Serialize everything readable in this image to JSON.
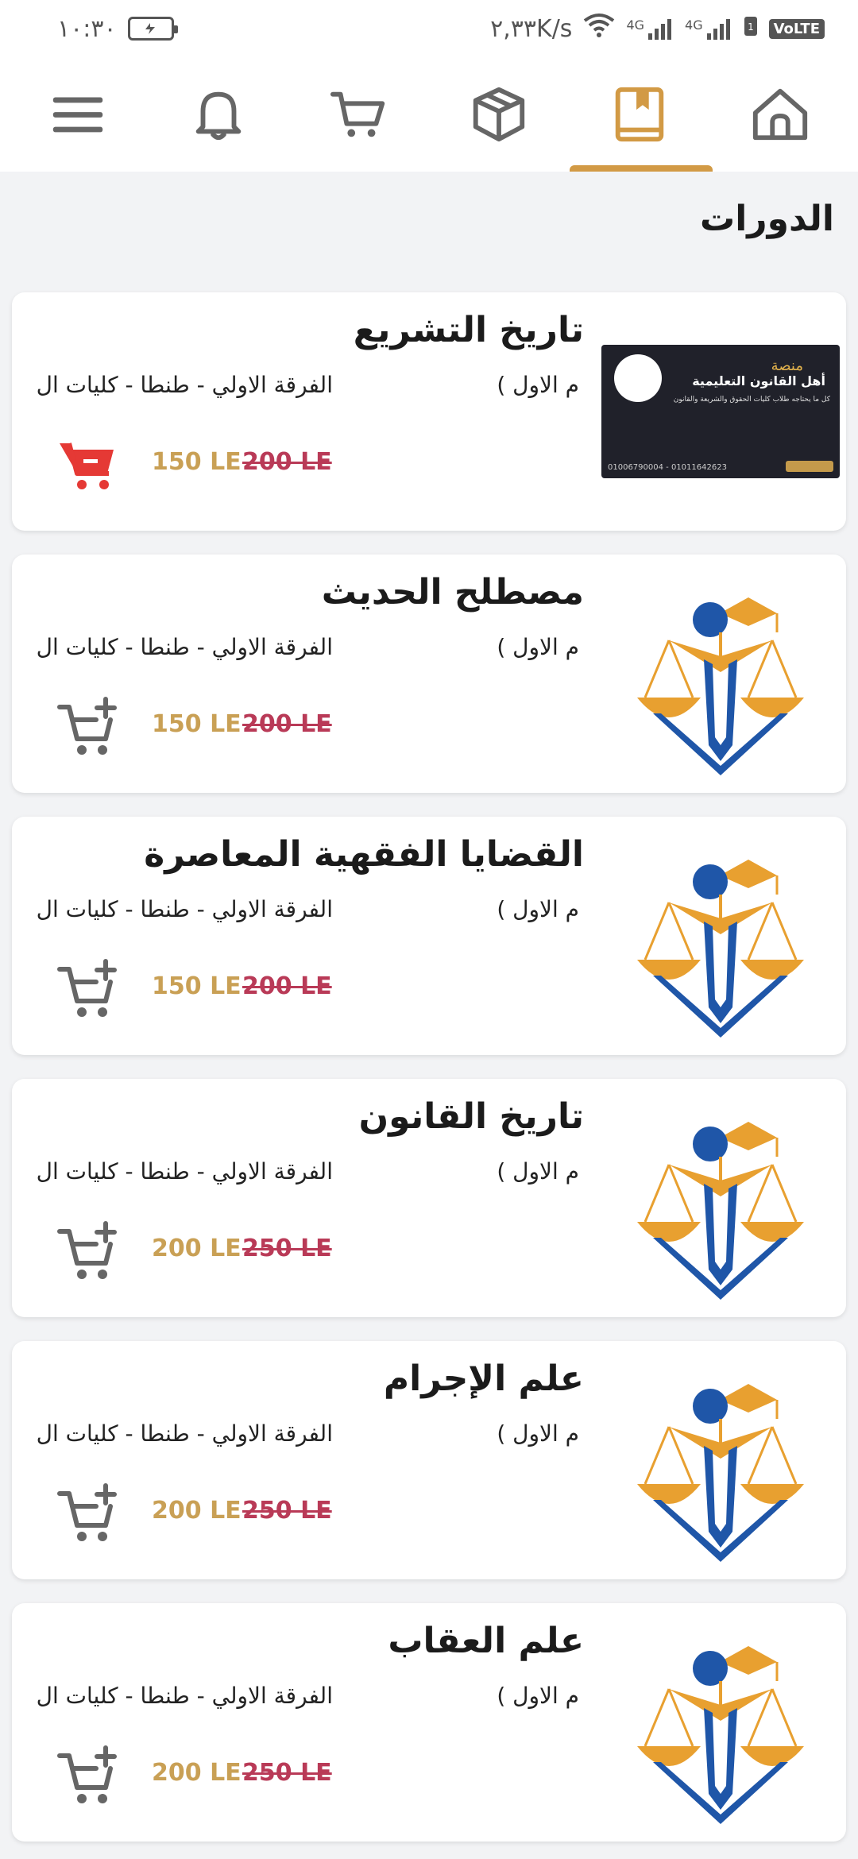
{
  "status_bar": {
    "time": "١٠:٣٠",
    "net_speed": "٢,٣٣K/s",
    "net_4g_1": "4G",
    "net_4g_2": "4G",
    "volte": "VoLTE"
  },
  "nav": {
    "items": [
      {
        "icon": "menu-icon"
      },
      {
        "icon": "bell-icon"
      },
      {
        "icon": "cart-icon"
      },
      {
        "icon": "box-icon"
      },
      {
        "icon": "book-icon",
        "active": true
      },
      {
        "icon": "home-icon"
      }
    ],
    "accent": "#d29a45"
  },
  "page": {
    "title": "الدورات"
  },
  "courses": [
    {
      "title": "تاريخ التشريع",
      "sub_right": "م الاول )",
      "sub_left": "الفرقة الاولي - طنطا - كليات ال",
      "price": "150 LE",
      "old_price": "200 LE",
      "cart_state": "in-cart",
      "thumb": "banner",
      "banner": {
        "line1": "منصة",
        "line2": "أهل القانون التعليمية",
        "line3": "كل ما يحتاجه طلاب كليات الحقوق والشريعة والقانون",
        "phone": "01006790004 - 01011642623"
      }
    },
    {
      "title": "مصطلح الحديث",
      "sub_right": "م الاول )",
      "sub_left": "الفرقة الاولي - طنطا - كليات ال",
      "price": "150 LE",
      "old_price": "200 LE",
      "cart_state": "add",
      "thumb": "logo"
    },
    {
      "title": "القضايا الفقهية المعاصرة",
      "sub_right": "م الاول )",
      "sub_left": "الفرقة الاولي - طنطا - كليات ال",
      "price": "150 LE",
      "old_price": "200 LE",
      "cart_state": "add",
      "thumb": "logo"
    },
    {
      "title": "تاريخ القانون",
      "sub_right": "م الاول )",
      "sub_left": "الفرقة الاولي - طنطا - كليات ال",
      "price": "200 LE",
      "old_price": "250 LE",
      "cart_state": "add",
      "thumb": "logo"
    },
    {
      "title": "علم الإجرام",
      "sub_right": "م الاول )",
      "sub_left": "الفرقة الاولي - طنطا - كليات ال",
      "price": "200 LE",
      "old_price": "250 LE",
      "cart_state": "add",
      "thumb": "logo"
    },
    {
      "title": "علم العقاب",
      "sub_right": "م الاول )",
      "sub_left": "الفرقة الاولي - طنطا - كليات ال",
      "price": "200 LE",
      "old_price": "250 LE",
      "cart_state": "add",
      "thumb": "logo"
    }
  ],
  "colors": {
    "price": "#c9a055",
    "old_price": "#b93a57",
    "cart_active": "#e53935",
    "cart_default": "#666666",
    "logo_orange": "#e8a030",
    "logo_blue": "#1f56a8"
  }
}
